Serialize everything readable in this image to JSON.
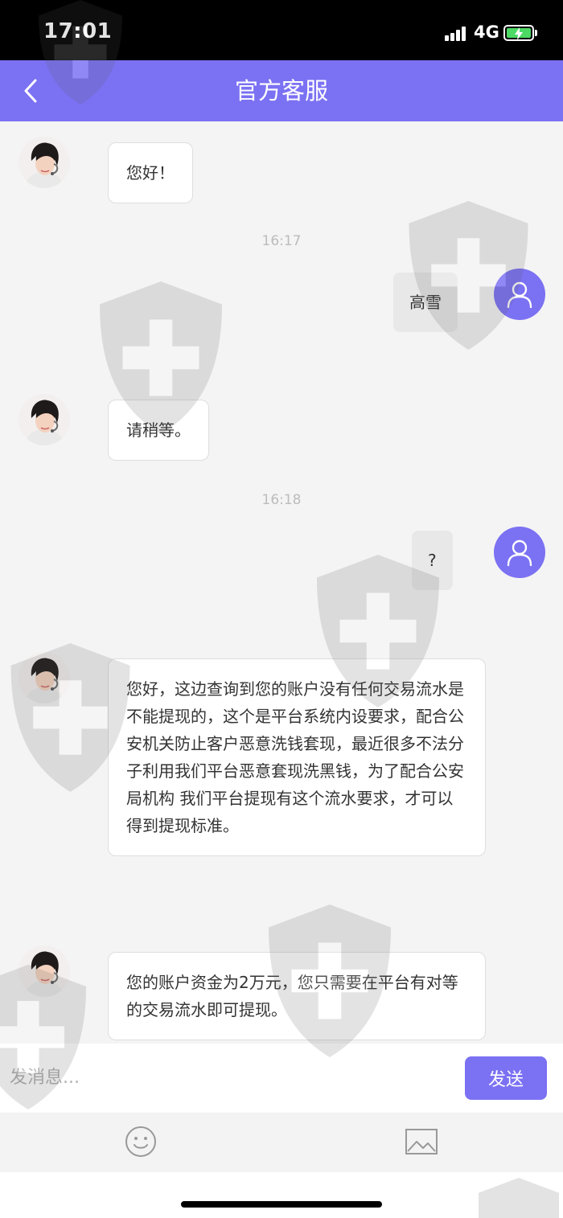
{
  "status_bar": {
    "time": "17:01",
    "network": "4G"
  },
  "header": {
    "title": "官方客服"
  },
  "messages": {
    "m1": "您好！",
    "t1": "16:17",
    "m2": "高雪",
    "m3": "请稍等。",
    "t2": "16:18",
    "m4": "?",
    "m5": "您好，这边查询到您的账户没有任何交易流水是不能提现的，这个是平台系统内设要求，配合公安机关防止客户恶意洗钱套现，最近很多不法分子利用我们平台恶意套现洗黑钱，为了配合公安局机构 我们平台提现有这个流水要求，才可以得到提现标准。",
    "m6": "您的账户资金为2万元，您只需要在平台有对等的交易流水即可提现。"
  },
  "input": {
    "placeholder": "发消息...",
    "send_label": "发送"
  },
  "icons": {
    "back": "chevron-left-icon",
    "emoji": "smiley-icon",
    "image": "image-icon",
    "user": "user-icon"
  },
  "colors": {
    "accent": "#7b71f3",
    "background": "#f4f4f4",
    "bubble_out": "#e8e8e8",
    "battery": "#4cd964"
  }
}
